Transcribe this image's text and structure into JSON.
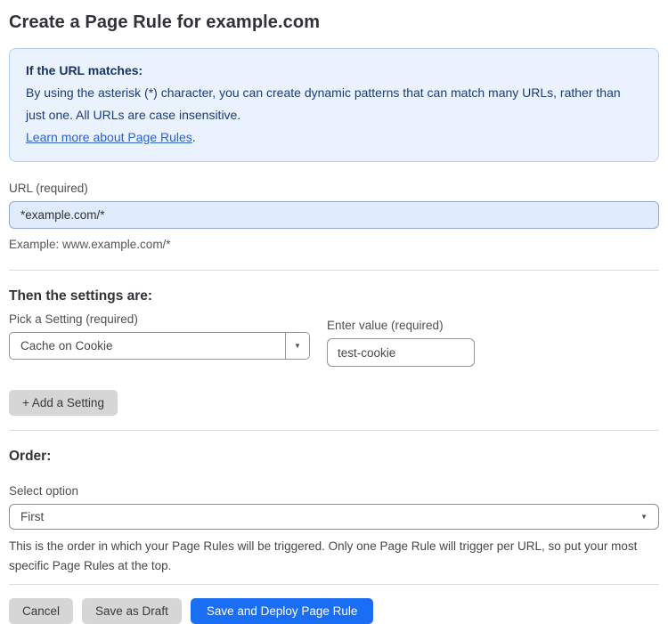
{
  "page": {
    "title": "Create a Page Rule for example.com"
  },
  "info_box": {
    "heading": "If the URL matches:",
    "body": "By using the asterisk (*) character, you can create dynamic patterns that can match many URLs, rather than just one. All URLs are case insensitive.",
    "link_label": "Learn more about Page Rules",
    "link_suffix": "."
  },
  "url_field": {
    "label": "URL (required)",
    "value": "*example.com/*",
    "helper": "Example: www.example.com/*"
  },
  "settings": {
    "heading": "Then the settings are:",
    "setting_select": {
      "label": "Pick a Setting (required)",
      "value": "Cache on Cookie"
    },
    "value_field": {
      "label": "Enter value (required)",
      "value": "test-cookie"
    },
    "add_button_label": "+ Add a Setting"
  },
  "order": {
    "heading": "Order:",
    "select_label": "Select option",
    "select_value": "First",
    "helper": "This is the order in which your Page Rules will be triggered. Only one Page Rule will trigger per URL, so put your most specific Page Rules at the top."
  },
  "actions": {
    "cancel_label": "Cancel",
    "save_draft_label": "Save as Draft",
    "save_deploy_label": "Save and Deploy Page Rule"
  },
  "icons": {
    "dropdown_arrow": "▼"
  },
  "colors": {
    "accent_blue": "#1a6ef5",
    "info_box_bg": "#e9f2fd",
    "info_box_border": "#b5d0f0",
    "info_text": "#1d3c78",
    "link_blue": "#2e63c8",
    "url_input_bg": "#e0ebfb",
    "gray_button_bg": "#d6d6d6"
  }
}
